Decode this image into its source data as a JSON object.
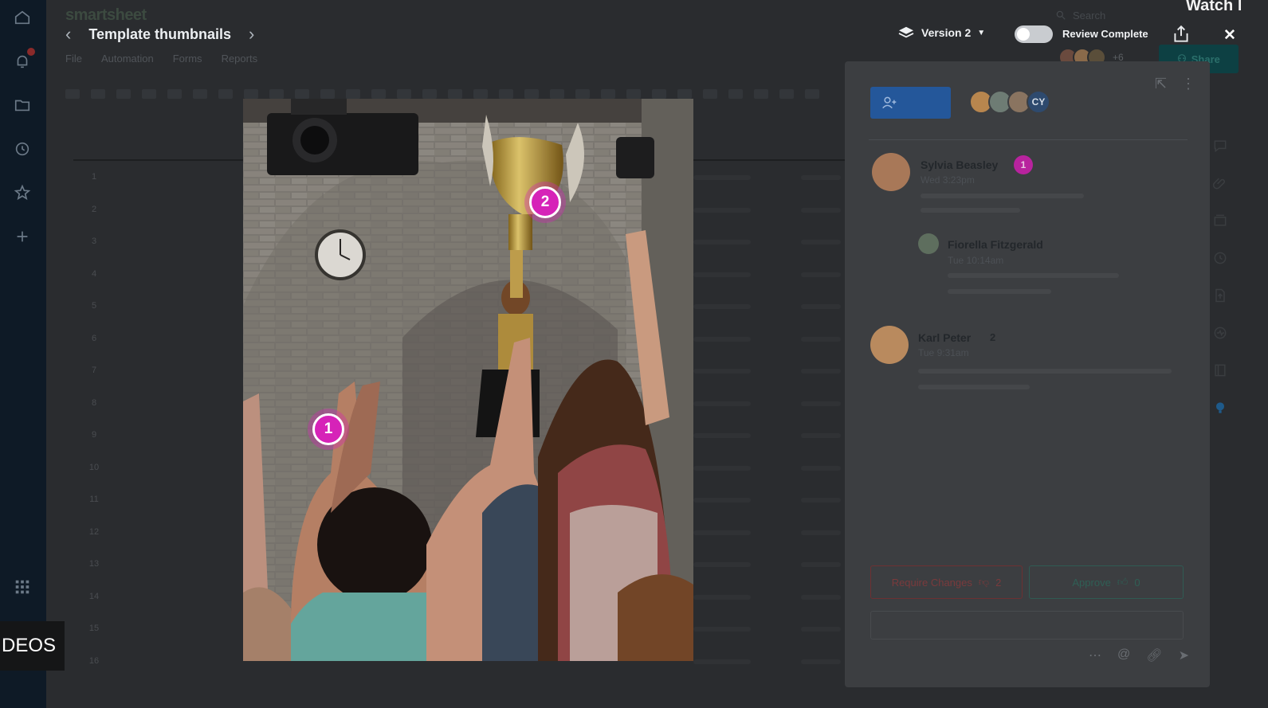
{
  "app": {
    "logo": "smartsheet",
    "sheet_title": "Template thumbnails"
  },
  "menu": [
    "File",
    "Automation",
    "Forms",
    "Reports"
  ],
  "search": {
    "placeholder": "Search"
  },
  "video_overlay": {
    "watch": "Watch l",
    "videos": "DEOS"
  },
  "header": {
    "version_label": "Version 2",
    "review_label": "Review Complete",
    "share_label": "Share",
    "extra_collaborators": "+6"
  },
  "rows": [
    "1",
    "2",
    "3",
    "4",
    "5",
    "6",
    "7",
    "8",
    "9",
    "10",
    "11",
    "12",
    "13",
    "14",
    "15",
    "16"
  ],
  "image_markers": [
    {
      "label": "1"
    },
    {
      "label": "2"
    }
  ],
  "panel": {
    "initials_avatar": "CY",
    "comments": [
      {
        "author": "Sylvia Beasley",
        "time": "Wed 3:23pm",
        "badge": "1"
      },
      {
        "author": "Fiorella Fitzgerald",
        "time": "Tue 10:14am"
      },
      {
        "author": "Karl Peter",
        "time": "Tue 9:31am",
        "count": "2"
      }
    ],
    "require_changes_label": "Require Changes",
    "require_changes_count": "2",
    "approve_label": "Approve",
    "approve_count": "0"
  },
  "colors": {
    "marker": "#d623b8",
    "primary_button": "#24579a",
    "share_button": "#0d4043",
    "nav_rail": "#0e1a26"
  },
  "icons": {
    "left_nav": [
      "home-icon",
      "bell-icon",
      "folder-icon",
      "clock-icon",
      "star-icon",
      "plus-icon",
      "apps-grid-icon"
    ],
    "right_panel": [
      "comment-icon",
      "attachment-icon",
      "proof-icon",
      "activity-icon",
      "publish-icon",
      "summary-icon",
      "forms-icon",
      "help-icon"
    ]
  }
}
